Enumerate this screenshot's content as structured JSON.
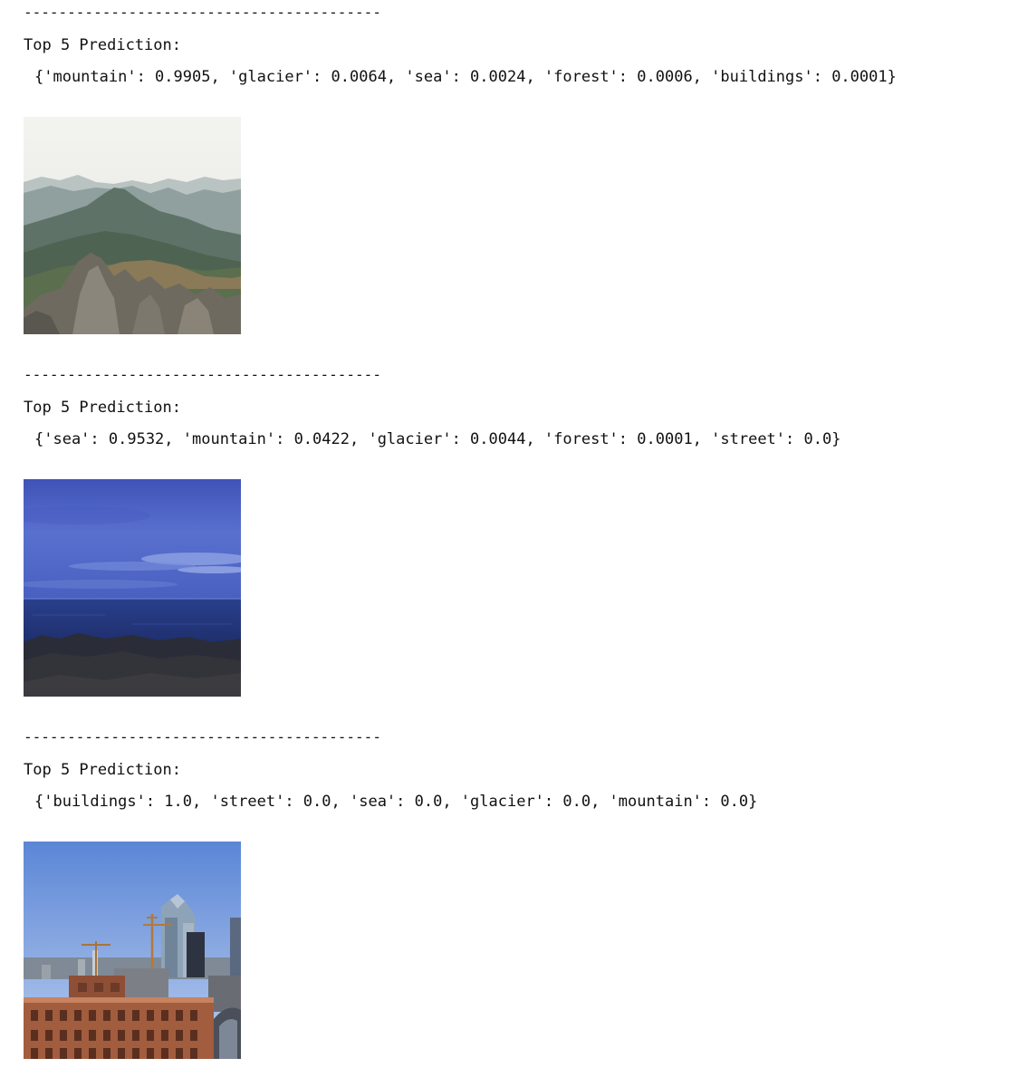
{
  "output": {
    "blocks": [
      {
        "divider": "-----------------------------------------",
        "heading": "Top 5 Prediction:",
        "predictions": "{'mountain': 0.9905, 'glacier': 0.0064, 'sea': 0.0024, 'forest': 0.0006, 'buildings': 0.0001}",
        "image_subject": "mountain"
      },
      {
        "divider": "-----------------------------------------",
        "heading": "Top 5 Prediction:",
        "predictions": "{'sea': 0.9532, 'mountain': 0.0422, 'glacier': 0.0044, 'forest': 0.0001, 'street': 0.0}",
        "image_subject": "sea"
      },
      {
        "divider": "-----------------------------------------",
        "heading": "Top 5 Prediction:",
        "predictions": "{'buildings': 1.0, 'street': 0.0, 'sea': 0.0, 'glacier': 0.0, 'mountain': 0.0}",
        "image_subject": "buildings"
      }
    ]
  }
}
